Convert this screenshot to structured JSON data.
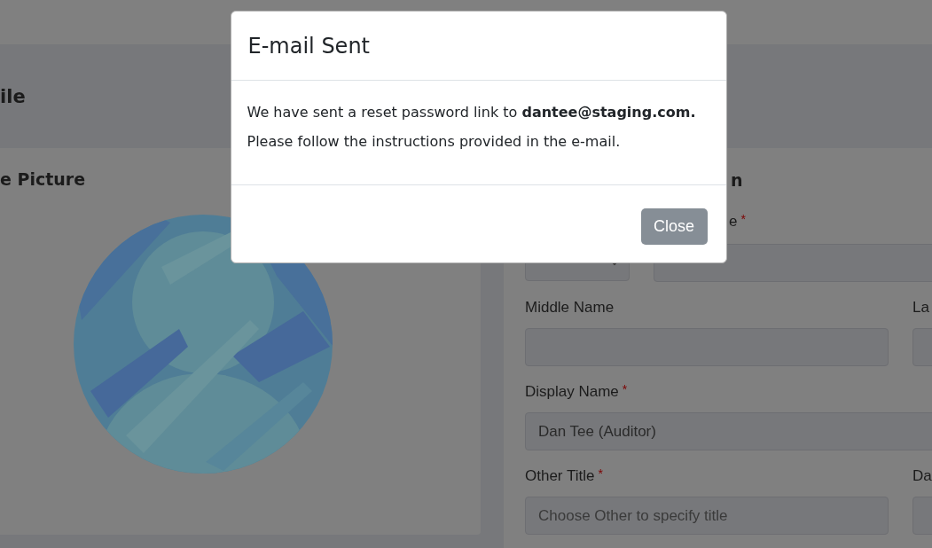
{
  "page_header": {
    "title": "ile"
  },
  "picture_card": {
    "title": "e Picture"
  },
  "details": {
    "title": "n",
    "name_row": {
      "label": "e",
      "required_mark": "*"
    },
    "fields": [
      {
        "kind": "text",
        "label": "Middle Name",
        "side_label": "La"
      },
      {
        "kind": "wide",
        "label": "Display Name",
        "required_mark": "*",
        "value": "Dan Tee (Auditor)"
      },
      {
        "kind": "text",
        "label": "Other Title",
        "required_mark": "*",
        "placeholder": "Choose Other to specify title",
        "side_label": "Da"
      }
    ]
  },
  "modal": {
    "title": "E-mail Sent",
    "message": "We have sent a reset password link to **dantee@staging.com.**",
    "note": "Please follow the instructions provided in the e-mail.",
    "buttons": [
      "Close"
    ]
  }
}
